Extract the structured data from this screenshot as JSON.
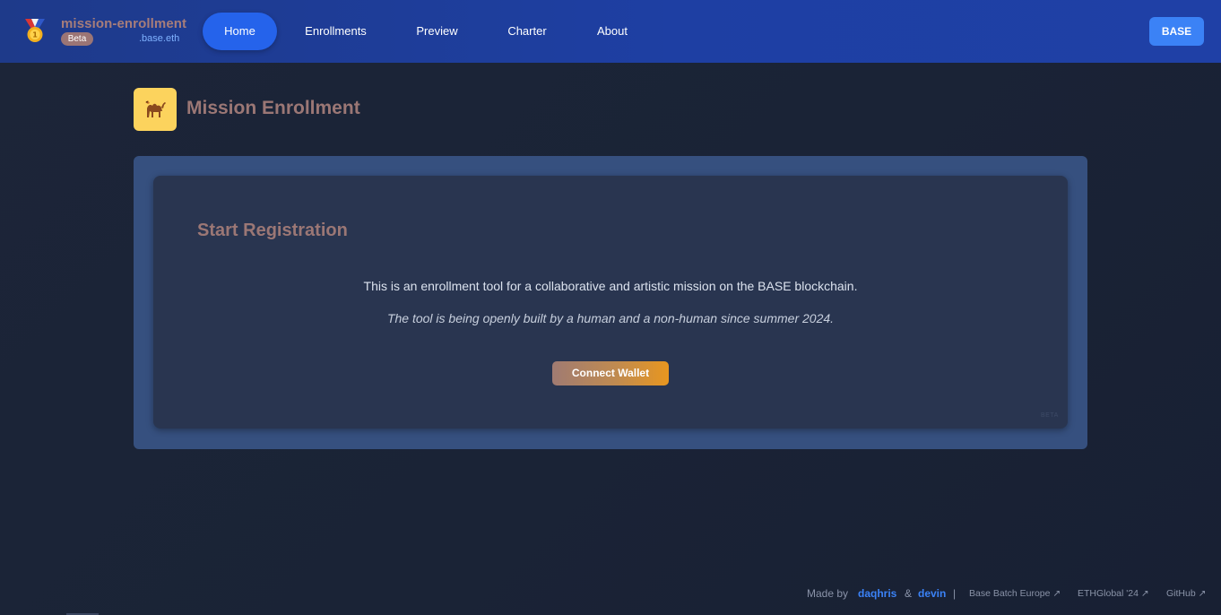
{
  "header": {
    "brand_name": "mission-enrollment",
    "beta_badge": "Beta",
    "brand_suffix": ".base.eth",
    "logo_icon": "medal-icon",
    "nav": [
      {
        "label": "Home",
        "active": true
      },
      {
        "label": "Enrollments",
        "active": false
      },
      {
        "label": "Preview",
        "active": false
      },
      {
        "label": "Charter",
        "active": false
      },
      {
        "label": "About",
        "active": false
      }
    ],
    "base_button": "BASE"
  },
  "page": {
    "title": "Mission Enrollment",
    "title_icon": "camel-icon"
  },
  "card": {
    "heading": "Start Registration",
    "description": "This is an enrollment tool for a collaborative and artistic mission on the BASE blockchain.",
    "note": "The tool is being openly built by a human and a non-human since summer 2024.",
    "connect_button": "Connect Wallet",
    "watermark": "BETA"
  },
  "footer": {
    "made_by": "Made by",
    "author1": "daqhris",
    "and": "&",
    "author2": "devin",
    "separator": "|",
    "links": [
      "Base Batch Europe ↗",
      "ETHGlobal '24 ↗",
      "GitHub ↗"
    ]
  },
  "colors": {
    "header_bg": "#1e3a8a",
    "active_tab": "#2563eb",
    "accent_blue": "#3b82f6",
    "title_color": "#9b7775",
    "page_bg": "#1b2437",
    "card_outer": "#36507f",
    "card_inner": "#293550",
    "button_gradient_end": "#e8961f"
  }
}
